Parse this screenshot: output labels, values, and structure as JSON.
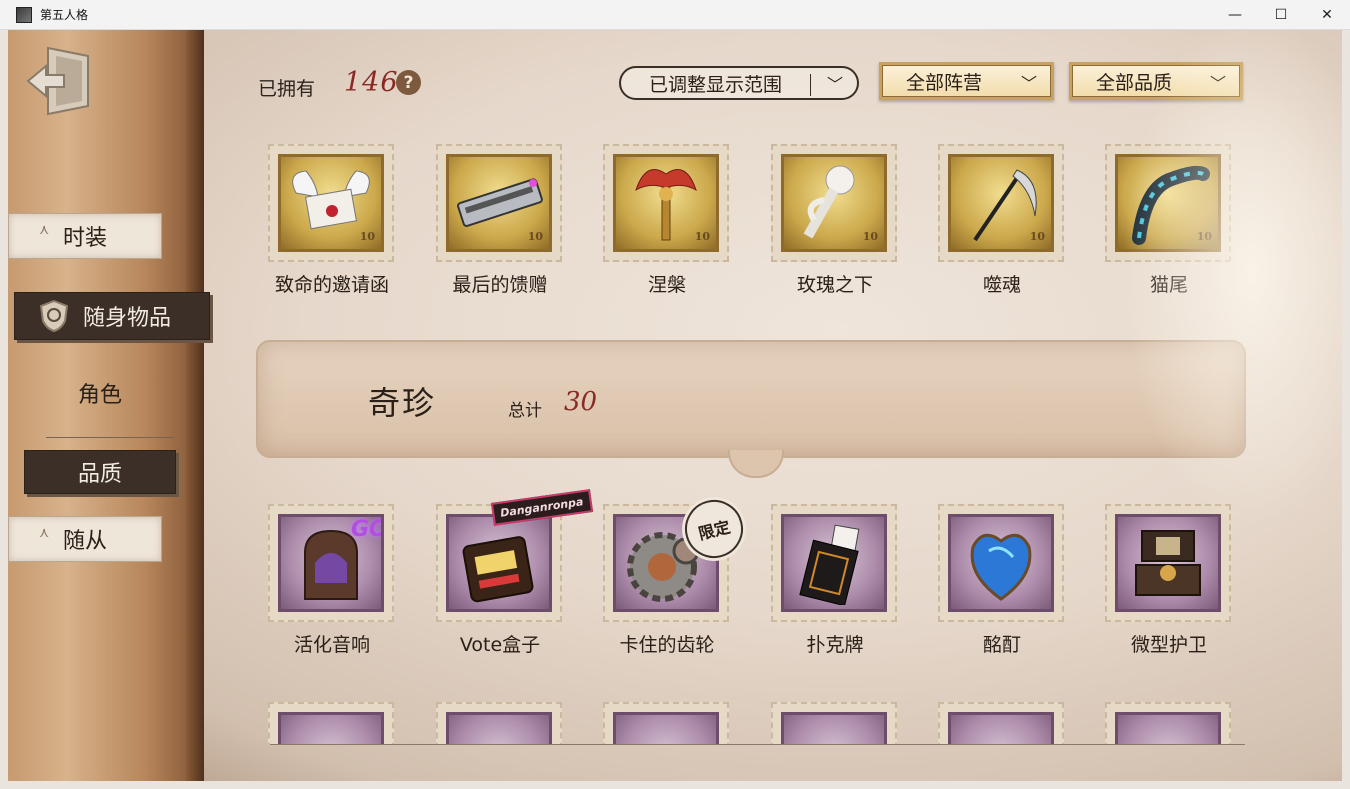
{
  "window": {
    "title": "第五人格",
    "controls": [
      "—",
      "☐",
      "✕"
    ]
  },
  "sidebar": {
    "items": [
      {
        "label": "时装"
      },
      {
        "label": "随身物品"
      },
      {
        "label": "角色"
      },
      {
        "label": "品质"
      },
      {
        "label": "随从"
      }
    ]
  },
  "header": {
    "owned_label": "已拥有",
    "owned_count": "146",
    "help": "?",
    "range_filter": "已调整显示范围",
    "camp_filter": "全部阵营",
    "quality_filter": "全部品质"
  },
  "gold_section": {
    "stamp_value": "10",
    "items": [
      {
        "name": "致命的邀请函",
        "icon": "winged-letter-icon"
      },
      {
        "name": "最后的馈赠",
        "icon": "harmonica-icon"
      },
      {
        "name": "涅槃",
        "icon": "phoenix-scepter-icon"
      },
      {
        "name": "玫瑰之下",
        "icon": "white-rose-icon"
      },
      {
        "name": "噬魂",
        "icon": "scythe-icon"
      },
      {
        "name": "猫尾",
        "icon": "cat-tail-icon"
      }
    ]
  },
  "rare_section": {
    "title": "奇珍",
    "total_label": "总计",
    "total_count": "30",
    "items": [
      {
        "name": "活化音响",
        "icon": "jukebox-icon",
        "fx": "GO!"
      },
      {
        "name": "Vote盒子",
        "icon": "slot-machine-icon",
        "badge": "Danganronpa"
      },
      {
        "name": "卡住的齿轮",
        "icon": "gear-icon",
        "badge": "限定"
      },
      {
        "name": "扑克牌",
        "icon": "playing-cards-icon"
      },
      {
        "name": "酩酊",
        "icon": "blue-heart-icon"
      },
      {
        "name": "微型护卫",
        "icon": "treasure-chest-icon"
      }
    ]
  },
  "colors": {
    "accent_red": "#8a2a25",
    "gold_stamp": "#cba84b",
    "purple_stamp": "#ab8aa9",
    "active_nav": "#3b2f27"
  }
}
